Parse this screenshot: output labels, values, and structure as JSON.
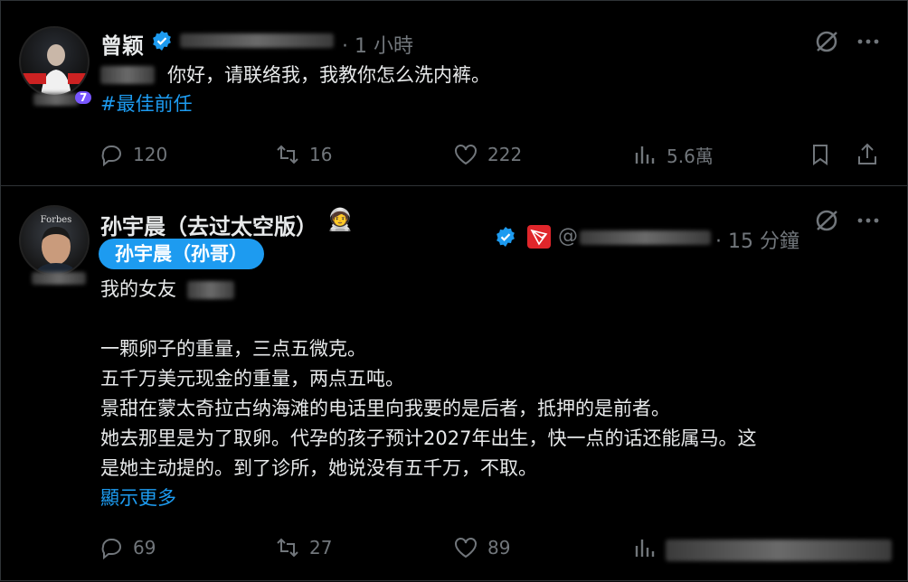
{
  "tweets": [
    {
      "author": "曾颖",
      "time": "· 1 小時",
      "avatar_badge": "7",
      "text_line": "你好，请联络我，我教你怎么洗内裤。",
      "hashtag": "#最佳前任",
      "replies": "120",
      "retweets": "16",
      "likes": "222",
      "views": "5.6萬"
    },
    {
      "author": "孙宇晨（去过太空版）",
      "author_tag": "孙宇晨（孙哥）",
      "avatar_text": "Forbes",
      "handle_prefix": "@",
      "time": "· 15 分鐘",
      "intro": "我的女友",
      "lines": [
        "一颗卵子的重量，三点五微克。",
        "五千万美元现金的重量，两点五吨。",
        "景甜在蒙太奇拉古纳海滩的电话里向我要的是后者，抵押的是前者。",
        "她去那里是为了取卵。代孕的孩子预计2027年出生，快一点的话还能属马。这",
        "是她主动提的。到了诊所，她说没有五千万，不取。"
      ],
      "show_more": "顯示更多",
      "replies": "69",
      "retweets": "27",
      "likes": "89"
    }
  ],
  "colors": {
    "accent": "#1d9bf0",
    "muted": "#71767b",
    "text": "#e7e9ea",
    "badge": "#7856ff"
  },
  "icons": [
    "verified-icon",
    "grok-icon",
    "more-icon",
    "reply-icon",
    "retweet-icon",
    "like-icon",
    "views-icon",
    "bookmark-icon",
    "share-icon"
  ]
}
